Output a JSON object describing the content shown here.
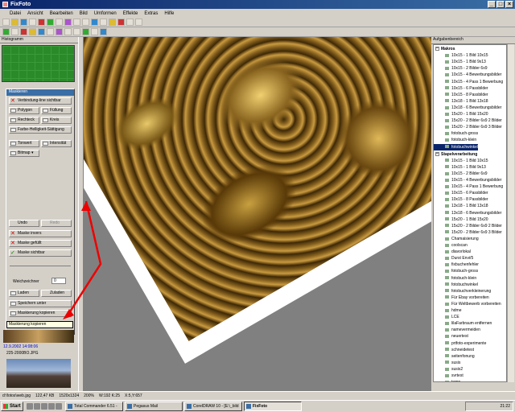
{
  "window": {
    "title": "FixFoto"
  },
  "menu": [
    "Datei",
    "Ansicht",
    "Bearbeiten",
    "Bild",
    "Umformen",
    "Effekte",
    "Extras",
    "Hilfe"
  ],
  "left_panel": {
    "histogram_title": "Histogramm",
    "mask_panel_title": "Maskieren",
    "mask_connect": "Verbindung-line sichtbar",
    "btn_polygon": "Polygon",
    "btn_fuellung": "Füllung",
    "btn_rechteck": "Rechteck",
    "btn_kreis": "Kreis",
    "btn_farbe": "Farbe-Helligkeit-Sättigung",
    "btn_tonwert": "Tonwert",
    "btn_intensitaet": "Intensität",
    "btn_bitmap": "Bitmap",
    "btn_undo": "Undo",
    "btn_redo": "Redo",
    "btn_maske_invert": "Maske invers",
    "btn_maske_gefuellt": "Maske gefüllt",
    "btn_maske_sichtbar": "Maske sichtbar",
    "weichzeichner_label": "Weichzeichner",
    "weichzeichner_value": "0",
    "btn_laden": "Laden",
    "btn_zuladen": "Zuladen",
    "btn_speichern": "Speichern unter",
    "btn_maskierung_kopieren": "Maskierung kopieren",
    "tooltip": "Maskierung kopieren",
    "thumb_date": "12.9.2002 14:08:06",
    "thumb_name": "225-2000BO.JPG"
  },
  "right_panel": {
    "title": "Aufgabenbereich",
    "group_makros": "Makros",
    "makros": [
      "10x15 - 1 Bild 10x15",
      "10x15 - 1 Bild 9x13",
      "10x15 - 2 Bilder 6x9",
      "10x15 - 4 Bewerbungsbilder",
      "10x15 - 4 Pass 1 Bewerbung",
      "10x15 - 6 Passbilder",
      "10x15 - 8 Passbilder",
      "13x18 - 1 Bild 13x18",
      "13x18 - 6 Bewerbungsbilder",
      "15x20 - 1 Bild 15x20",
      "15x20 - 2 Bilder 6x9 2 Bilder",
      "15x20 - 2 Bilder 6x9 3 Bilder",
      "fotobuch-gross",
      "fotobuch-klein",
      "fotobuchwinkel"
    ],
    "group_stapel": "Stapelverarbeitung",
    "stapel": [
      "10x15 - 1 Bild 10x15",
      "10x15 - 1 Bild 9x13",
      "10x15 - 2 Bilder 6x9",
      "10x15 - 4 Bewerbungsbilder",
      "10x15 - 4 Pass 1 Bewerbung",
      "10x15 - 6 Passbilder",
      "10x15 - 8 Passbilder",
      "13x18 - 1 Bild 13x18",
      "13x18 - 6 Bewerbungsbilder",
      "15x20 - 1 Bild 15x20",
      "15x20 - 2 Bilder 6x9 2 Bilder",
      "15x20 - 2 Bilder 6x9 3 Bilder",
      "Chamaisierung",
      "coolscan",
      "diavorlokal",
      "Durst Envi/5",
      "fixbuchenfehler",
      "fotobuch-gross",
      "fotobuch-klein",
      "fotobuchwinkel",
      "fotobuchverkleinerung",
      "Für Ebay vorbereiten",
      "Für Weltbewerb vorbereiten",
      "hdme",
      "LCE",
      "lilaFarbraum entfernen",
      "namevermeiden",
      "neuertest",
      "prtfoto-experimente",
      "schneidetest",
      "seitenfonung",
      "susis",
      "susis2",
      "svrtest",
      "temp"
    ]
  },
  "status": {
    "file": "d:\\fotos\\web.jpg",
    "size": "122,47 KB",
    "dims": "1520x1324",
    "zoom": "200%",
    "coords": "W:192 K:25",
    "xy": "X:5,Y:657"
  },
  "taskbar": {
    "start": "Start",
    "tasks": [
      "Total Commander 6.51 -",
      "Pegasus Mail",
      "CorelDRAW 10 - [E:\\_bild",
      "FixFoto"
    ],
    "clock": "21:22"
  }
}
